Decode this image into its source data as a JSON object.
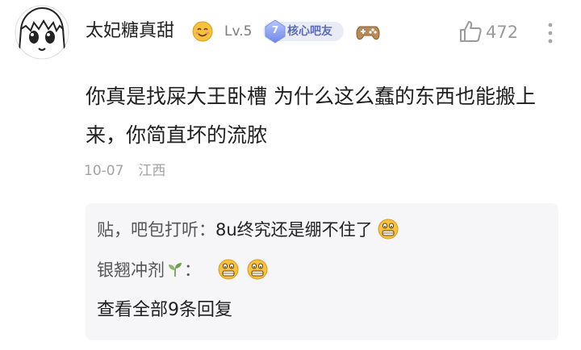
{
  "comment": {
    "username": "太妃糖真甜",
    "level": "Lv.5",
    "fan_badge": {
      "rank": "7",
      "label": "核心吧友"
    },
    "likes": "472",
    "text": "你真是找屎大王卧槽 为什么这么蠢的东西也能搬上来，你简直坏的流脓",
    "date": "10-07",
    "location": "江西"
  },
  "replies": [
    {
      "user": "贴，吧包打听",
      "separator": "：",
      "text": "8u终究还是绷不住了",
      "emoji_count": 1
    },
    {
      "user": "银翘冲剂",
      "separator": "：",
      "text": "",
      "emoji_count": 2
    }
  ],
  "view_all": "查看全部9条回复",
  "icons": {
    "avatar": "anime-face-avatar",
    "name_emoji": "blush-smile-emoji",
    "fan_gem": "diamond-badge-icon",
    "game": "gamepad-icon",
    "like": "thumbs-up-icon",
    "more": "vertical-ellipsis-icon",
    "reply_emoji": "grimace-emoji",
    "sprout": "sprout-icon"
  },
  "colors": {
    "badge_bg": "#e9ebf6",
    "badge_text": "#5b6bb8",
    "reply_bg": "#f6f5f8",
    "muted": "#a3a3a3"
  }
}
